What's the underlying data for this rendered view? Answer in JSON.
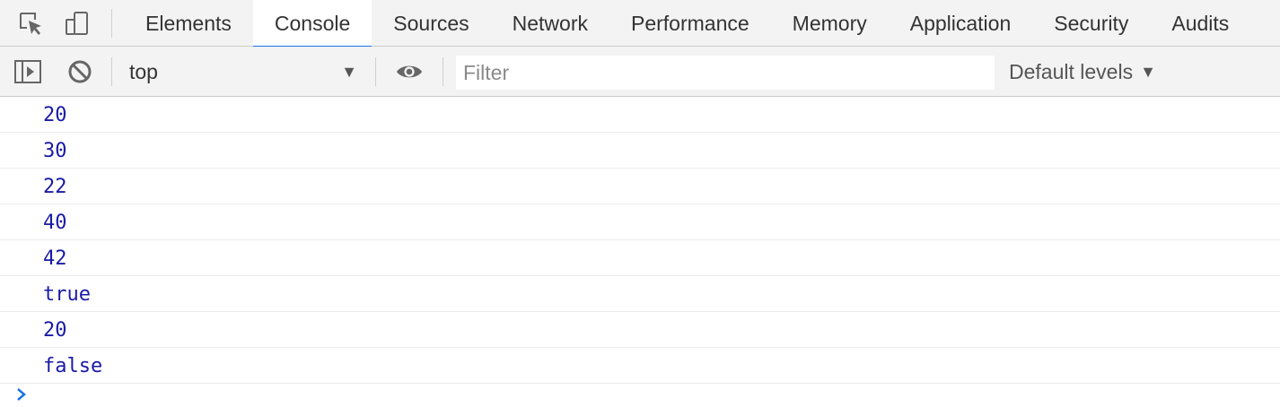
{
  "devtools": {
    "toolbar_icons": {
      "inspect": "inspect-element-icon",
      "device": "device-toolbar-icon"
    },
    "tabs": [
      {
        "label": "Elements",
        "active": false
      },
      {
        "label": "Console",
        "active": true
      },
      {
        "label": "Sources",
        "active": false
      },
      {
        "label": "Network",
        "active": false
      },
      {
        "label": "Performance",
        "active": false
      },
      {
        "label": "Memory",
        "active": false
      },
      {
        "label": "Application",
        "active": false
      },
      {
        "label": "Security",
        "active": false
      },
      {
        "label": "Audits",
        "active": false
      }
    ],
    "active_tab_accent": "#1a73e8"
  },
  "console": {
    "toolbar": {
      "sidebar_icon": "show-sidebar-icon",
      "clear_icon": "clear-console-icon",
      "context": "top",
      "eye_icon": "live-expression-eye-icon",
      "filter_placeholder": "Filter",
      "filter_value": "",
      "levels_label": "Default levels"
    },
    "messages": [
      "20",
      "30",
      "22",
      "40",
      "42",
      "true",
      "20",
      "false"
    ],
    "value_color": "#1a1aa6",
    "prompt_icon": "prompt-chevron-icon"
  }
}
